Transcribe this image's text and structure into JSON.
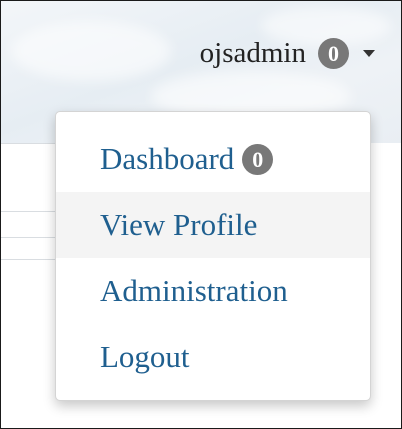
{
  "user_menu": {
    "username": "ojsadmin",
    "badge_count": "0"
  },
  "dropdown": {
    "items": [
      {
        "label": "Dashboard",
        "badge": "0"
      },
      {
        "label": "View Profile",
        "highlighted": true
      },
      {
        "label": "Administration"
      },
      {
        "label": "Logout"
      }
    ]
  },
  "colors": {
    "link": "#1f5f8f",
    "badge_bg": "#787878",
    "hover_bg": "#f4f4f4"
  },
  "icons": {
    "toggle": "caret-down-icon"
  }
}
